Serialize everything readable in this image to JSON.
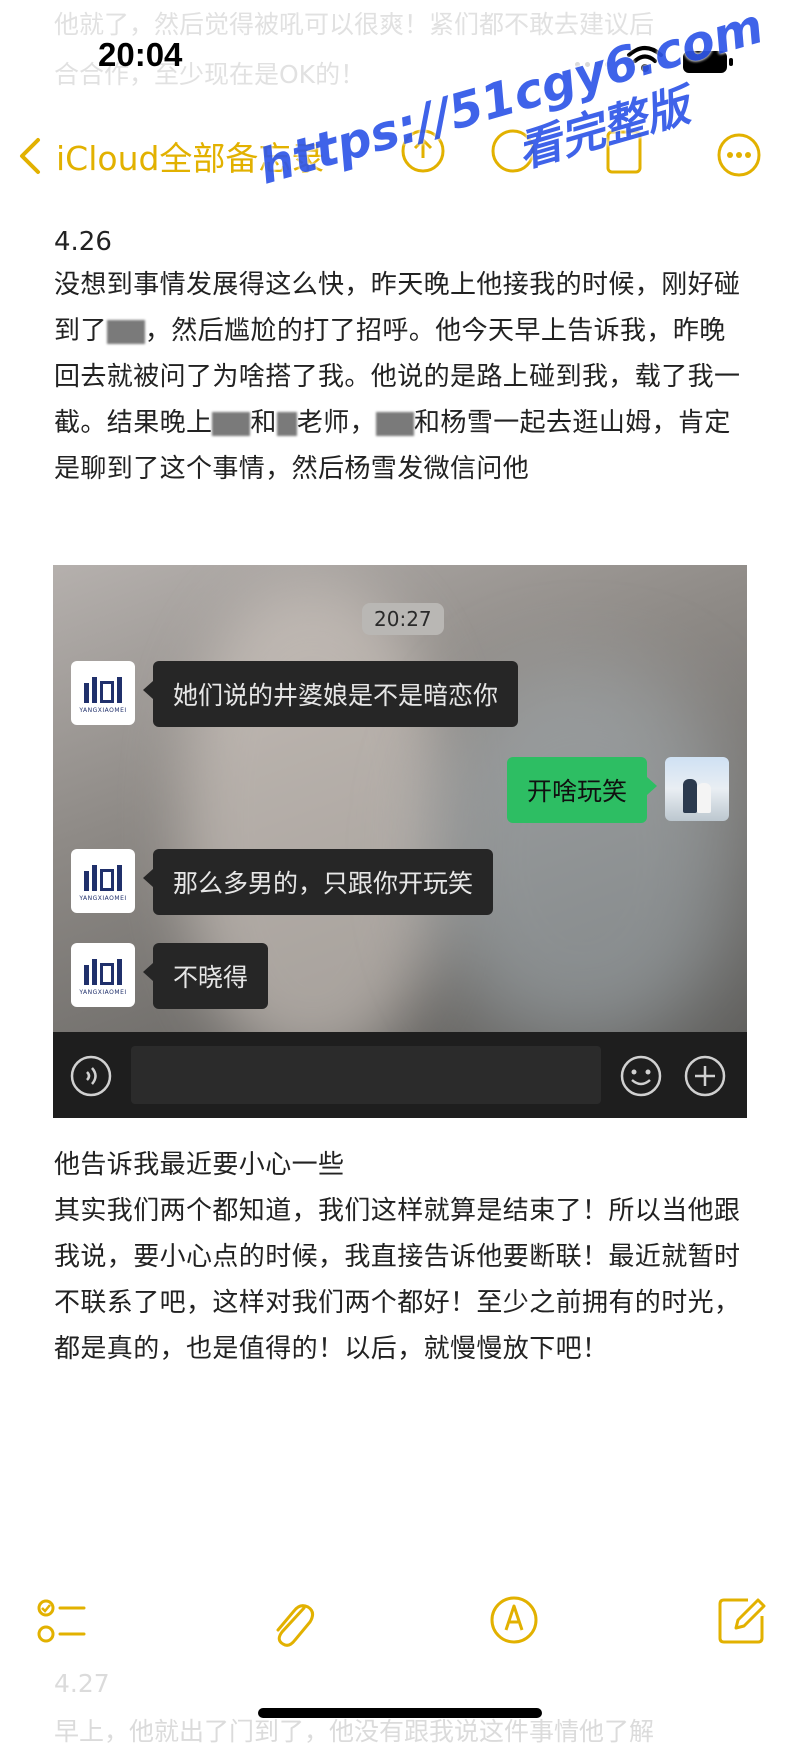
{
  "background_text": {
    "top_line1": "他就了，然后觉得被吼可以很爽！紧们都不敢去建议后",
    "top_line2": "合合作，至少现在是OK的！",
    "bottom_line1": "4.27",
    "bottom_line2": "早上，他就出了门到了，他没有跟我说这件事情他了解"
  },
  "status_bar": {
    "time": "20:04"
  },
  "nav": {
    "back_label": "iCloud全部备忘录",
    "icons": [
      "chevron-left-icon",
      "share-icon",
      "markup-icon",
      "more-icon"
    ]
  },
  "watermark": {
    "url": "https://51cgy6.com",
    "subtitle": "看完整版"
  },
  "note": {
    "date": "4.26",
    "p1_a": "没想到事情发展得这么快，昨天晚上他接我的时候，刚好碰到了",
    "p1_b": "，然后尴尬的打了招呼。他今天早上告诉我，昨晚回去就被问了为啥搭了我。他说的是路上碰到我，载了我一截。结果晚上",
    "p1_c": "和",
    "p1_d": "老师，",
    "p1_e": "和杨雪一起去逛山姆，肯定是聊到了这个事情，然后杨雪发微信问他",
    "after_1": "他告诉我最近要小心一些",
    "after_2": "其实我们两个都知道，我们这样就算是结束了！所以当他跟我说，要小心点的时候，我直接告诉他要断联！最近就暂时不联系了吧，这样对我们两个都好！至少之前拥有的时光，都是真的，也是值得的！以后，就慢慢放下吧！"
  },
  "chat": {
    "timestamp": "20:27",
    "logo_text": "YANGXIAOMEI",
    "messages": [
      {
        "side": "left",
        "text": "她们说的井婆娘是不是暗恋你"
      },
      {
        "side": "right",
        "text": "开啥玩笑"
      },
      {
        "side": "left",
        "text": "那么多男的，只跟你开玩笑"
      },
      {
        "side": "left",
        "text": "不晓得"
      }
    ]
  },
  "toolbar": {
    "icons": [
      "checklist-icon",
      "paperclip-icon",
      "pen-markup-icon",
      "compose-icon"
    ]
  },
  "colors": {
    "accent": "#e2b100",
    "watermark": "#2f56e8",
    "wechat_green": "#2dbe63"
  }
}
